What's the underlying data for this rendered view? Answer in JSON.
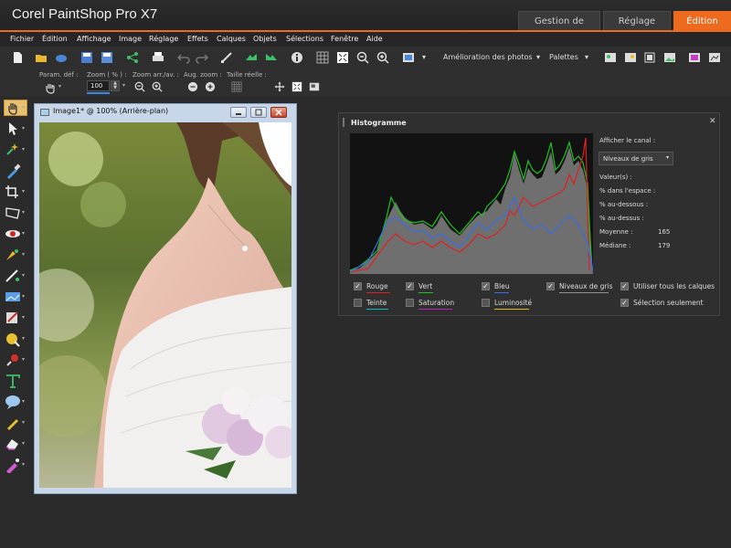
{
  "app": {
    "title": "Corel PaintShop Pro X7"
  },
  "workspace_tabs": [
    {
      "label": "Gestion de photos"
    },
    {
      "label": "Réglage"
    },
    {
      "label": "Édition"
    }
  ],
  "menu": [
    "Fichier",
    "Édition",
    "Affichage",
    "Image",
    "Réglage",
    "Effets",
    "Calques",
    "Objets",
    "Sélections",
    "Fenêtre",
    "Aide"
  ],
  "toolbar": {
    "enhance_label": "Amélioration des photos",
    "palettes_label": "Palettes"
  },
  "options": {
    "presets_label": "Param. déf :",
    "zoom_label": "Zoom ( % ) :",
    "zoom_value": "100",
    "zoom_inout_label": "Zoom arr./av. :",
    "zoom_more_label": "Aug. zoom :",
    "actual_size_label": "Taille réelle :"
  },
  "image_window": {
    "title": "Image1* @ 100% (Arrière-plan)"
  },
  "histogram": {
    "title": "Histogramme",
    "show_channel_label": "Afficher le canal :",
    "channel_value": "Niveaux de gris",
    "values_label": "Valeur(s) :",
    "space_pct_label": "% dans l'espace :",
    "below_pct_label": "% au-dessous :",
    "above_pct_label": "% au-dessus :",
    "mean_label": "Moyenne :",
    "mean_value": "165",
    "median_label": "Médiane :",
    "median_value": "179",
    "checks": [
      {
        "label": "Rouge",
        "checked": true,
        "color": "#e02020"
      },
      {
        "label": "Vert",
        "checked": true,
        "color": "#22c022"
      },
      {
        "label": "Bleu",
        "checked": true,
        "color": "#3a6ee8"
      },
      {
        "label": "Niveaux de gris",
        "checked": true,
        "color": "#909090"
      },
      {
        "label": "Teinte",
        "checked": false,
        "color": "#00c0c0"
      },
      {
        "label": "Saturation",
        "checked": false,
        "color": "#c020c0"
      },
      {
        "label": "Luminosité",
        "checked": false,
        "color": "#e0c000"
      }
    ],
    "use_all_layers_label": "Utiliser tous les calques",
    "selection_only_label": "Sélection seulement"
  },
  "colors": {
    "accent": "#ee6a1e",
    "window_frame": "#c7d6e8"
  }
}
